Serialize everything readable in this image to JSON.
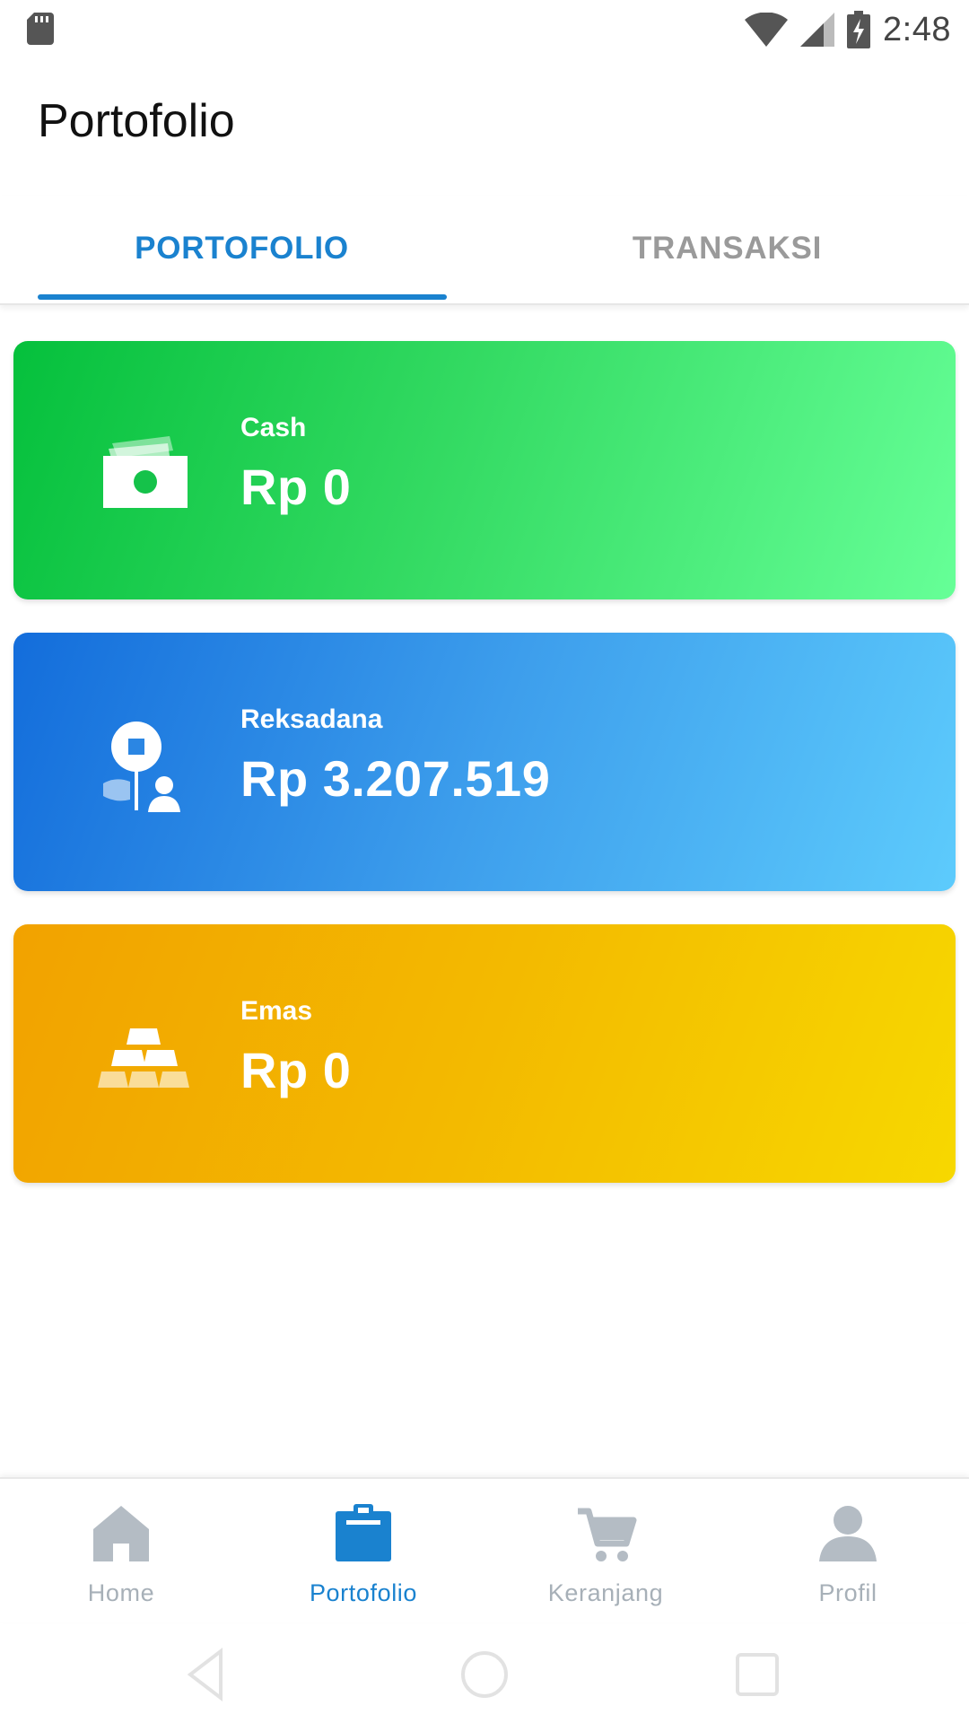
{
  "status_bar": {
    "time": "2:48"
  },
  "app_bar": {
    "title": "Portofolio"
  },
  "tabs": [
    {
      "label": "PORTOFOLIO",
      "active": true
    },
    {
      "label": "TRANSAKSI",
      "active": false
    }
  ],
  "cards": [
    {
      "label": "Cash",
      "value": "Rp 0",
      "icon": "cash-icon",
      "gradient": [
        "#05c03c",
        "#66ff97"
      ]
    },
    {
      "label": "Reksadana",
      "value": "Rp 3.207.519",
      "icon": "mutual-fund-icon",
      "gradient": [
        "#136ddb",
        "#5dcbfc"
      ]
    },
    {
      "label": "Emas",
      "value": "Rp 0",
      "icon": "gold-bars-icon",
      "gradient": [
        "#f2a200",
        "#f7d800"
      ]
    }
  ],
  "bottom_nav": [
    {
      "label": "Home",
      "icon": "home-icon",
      "active": false
    },
    {
      "label": "Portofolio",
      "icon": "clipboard-icon",
      "active": true
    },
    {
      "label": "Keranjang",
      "icon": "cart-icon",
      "active": false
    },
    {
      "label": "Profil",
      "icon": "person-icon",
      "active": false
    }
  ],
  "colors": {
    "accent": "#1a82cf",
    "inactive": "#a7b0b8"
  }
}
